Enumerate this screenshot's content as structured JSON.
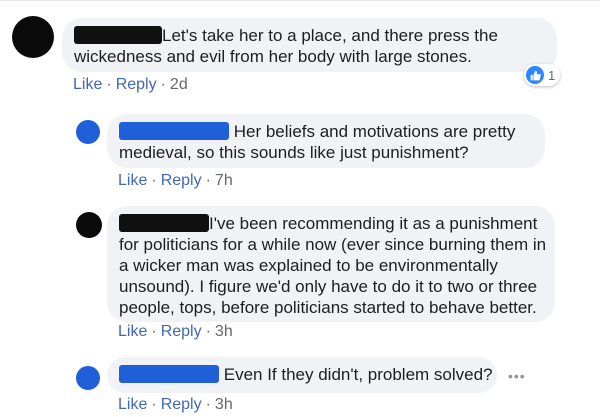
{
  "colors": {
    "bubble_bg": "#f0f2f5",
    "link": "#4267b2",
    "meta": "#65676b",
    "redaction_black": "#111111",
    "redaction_blue": "#1f5fd8",
    "like_blue": "#2d88ff"
  },
  "comments": [
    {
      "lines": [
        "Let's take her to a place, and there press the",
        "wickedness and evil from her body with large stones."
      ],
      "redaction": "black",
      "actions": {
        "like": "Like",
        "reply": "Reply",
        "sep": "·",
        "time": "2d"
      },
      "reaction": {
        "icon": "thumbs-up-icon",
        "count": "1"
      }
    },
    {
      "lines": [
        "Her beliefs and motivations are pretty",
        "medieval, so this sounds like just punishment?"
      ],
      "redaction": "blue",
      "actions": {
        "like": "Like",
        "reply": "Reply",
        "sep": "·",
        "time": "7h"
      }
    },
    {
      "lines": [
        "I've been recommending it as a punishment",
        "for politicians for a while now (ever since burning them in",
        "a wicker man was explained to be environmentally",
        "unsound). I figure we'd only have to do it to two or three",
        "people, tops, before politicians started to behave better."
      ],
      "redaction": "black",
      "actions": {
        "like": "Like",
        "reply": "Reply",
        "sep": "·",
        "time": "3h"
      }
    },
    {
      "lines": [
        "Even If they didn't, problem solved?"
      ],
      "redaction": "blue",
      "actions": {
        "like": "Like",
        "reply": "Reply",
        "sep": "·",
        "time": "3h"
      },
      "more": "•••"
    }
  ]
}
